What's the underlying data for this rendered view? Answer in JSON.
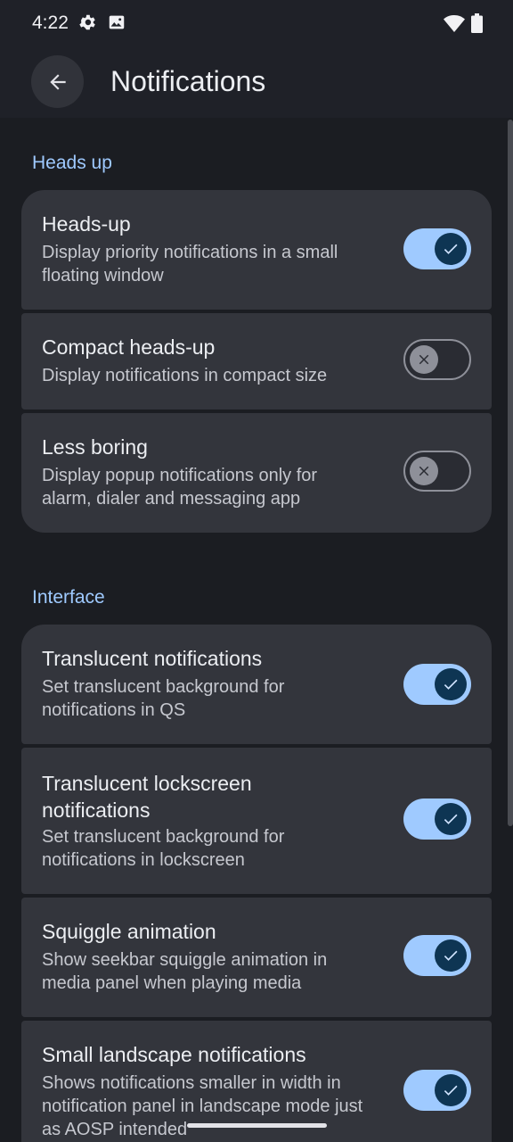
{
  "status": {
    "time": "4:22"
  },
  "header": {
    "title": "Notifications"
  },
  "sections": {
    "heads_up": {
      "label": "Heads up",
      "items": [
        {
          "title": "Heads-up",
          "desc": "Display priority notifications in a small floating window",
          "state": "on"
        },
        {
          "title": "Compact heads-up",
          "desc": "Display notifications in compact size",
          "state": "off"
        },
        {
          "title": "Less boring",
          "desc": "Display popup notifications only for alarm, dialer and messaging app",
          "state": "off"
        }
      ]
    },
    "interface": {
      "label": "Interface",
      "items": [
        {
          "title": "Translucent notifications",
          "desc": "Set translucent background for notifications in QS",
          "state": "on"
        },
        {
          "title": "Translucent lockscreen notifications",
          "desc": "Set translucent background for notifications in lockscreen",
          "state": "on"
        },
        {
          "title": "Squiggle animation",
          "desc": "Show seekbar squiggle animation in media panel when playing media",
          "state": "on"
        },
        {
          "title": "Small landscape notifications",
          "desc": "Shows notifications smaller in width in notification panel in landscape mode just as AOSP intended",
          "state": "on"
        }
      ]
    }
  },
  "colors": {
    "accent": "#9fcaff",
    "card": "#33353c",
    "background": "#1b1d22"
  }
}
